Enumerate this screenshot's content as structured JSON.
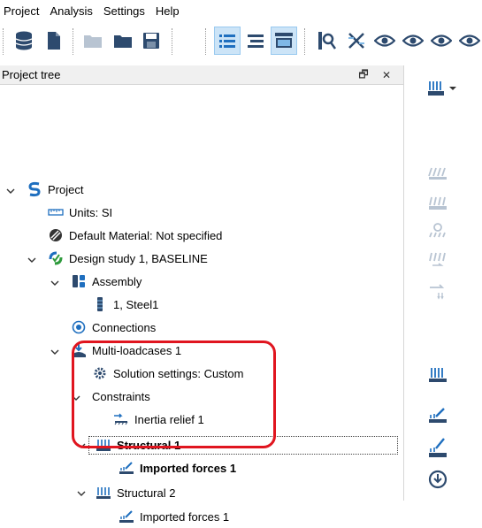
{
  "menu": [
    "Project",
    "Analysis",
    "Settings",
    "Help"
  ],
  "toolbar": {
    "icons": [
      "database-icon",
      "new-file-icon",
      "open-folder-disabled-icon",
      "folder-icon",
      "save-icon",
      "list-view-icon",
      "split-view-icon",
      "image-view-icon",
      "inspect-icon",
      "close-mesh-icon",
      "eye-icon",
      "eye-dropdown-icon"
    ]
  },
  "panel": {
    "title": "Project tree",
    "float_glyph": "🗗",
    "close_glyph": "✕"
  },
  "tree": {
    "project": "Project",
    "units": "Units: SI",
    "default_material": "Default Material: Not specified",
    "design_study": "Design study 1, BASELINE",
    "assembly": "Assembly",
    "part": "1, Steel1",
    "connections": "Connections",
    "multi_loadcases": "Multi-loadcases  1",
    "solution_settings": "Solution settings: Custom",
    "constraints": "Constraints",
    "inertia_relief": "Inertia relief 1",
    "structural_1": "Structural 1",
    "imported_forces_1a": "Imported forces 1",
    "structural_2": "Structural 2",
    "imported_forces_1b": "Imported forces 1"
  },
  "colors": {
    "highlight_box": "#e0151f",
    "brand_blue": "#1f6fbf",
    "icon_gray": "#555555"
  }
}
